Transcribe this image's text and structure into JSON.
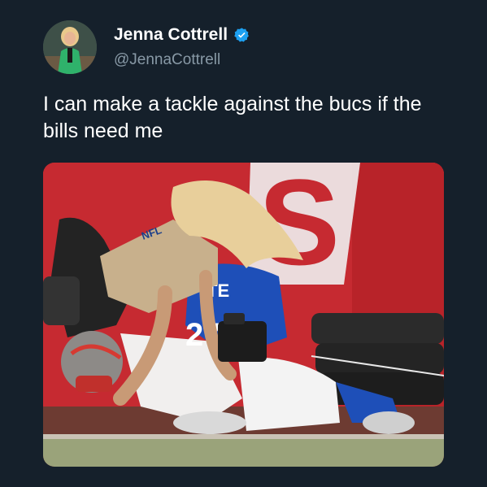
{
  "author": {
    "display_name": "Jenna Cottrell",
    "handle": "@JennaCottrell",
    "verified": true,
    "verified_icon": "verified-badge-icon",
    "verified_color": "#1da1f2"
  },
  "tweet": {
    "text": "I can make a tackle against the bucs if the bills need me"
  },
  "media": {
    "stadium_letter": "S",
    "jersey_text": "ITE",
    "jersey_number": "27",
    "helmet_text": "NFL",
    "jersey_color": "#1e4fb8",
    "wall_color": "#c62a31"
  },
  "colors": {
    "background": "#15202b",
    "text": "#ffffff",
    "secondary_text": "#8899a6"
  }
}
